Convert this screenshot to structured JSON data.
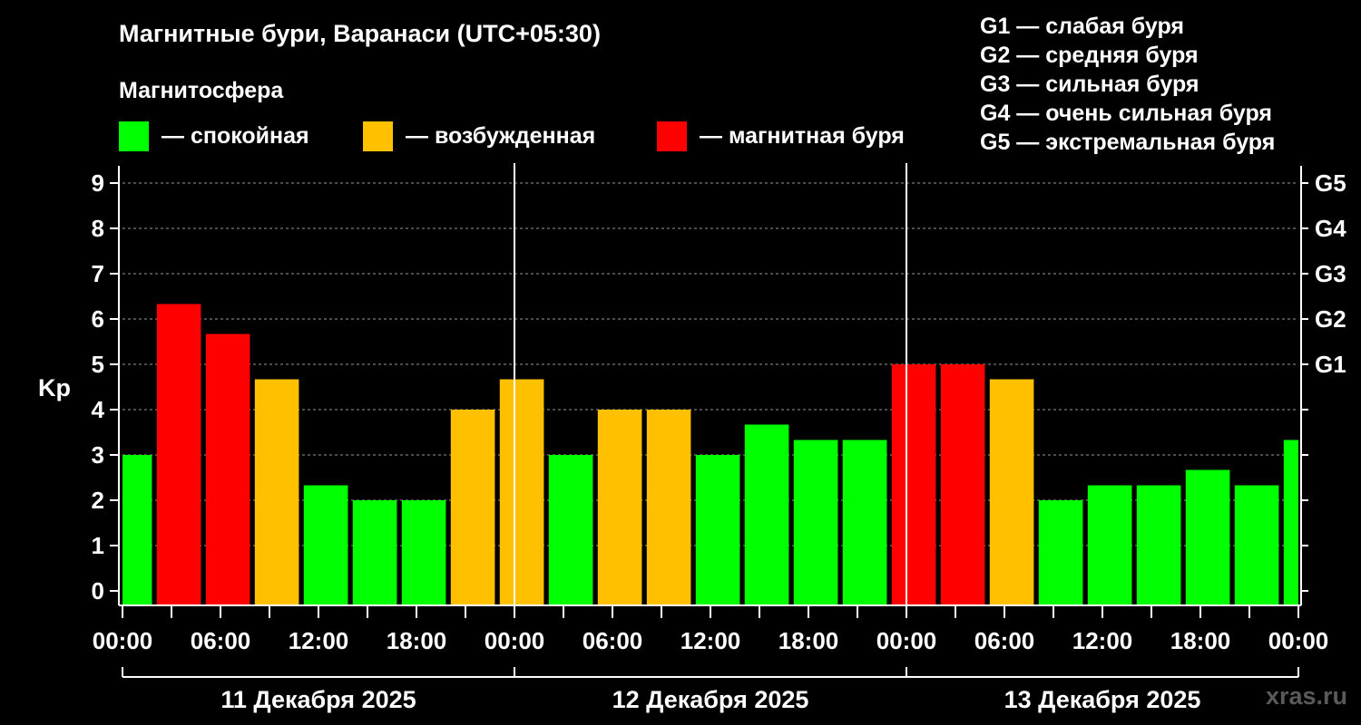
{
  "header": {
    "title": "Магнитные бури, Варанаси (UTC+05:30)",
    "legend_heading": "Магнитосфера"
  },
  "legend": [
    {
      "label": "— спокойная",
      "color": "#00ff00"
    },
    {
      "label": "— возбужденная",
      "color": "#ffc000"
    },
    {
      "label": "— магнитная буря",
      "color": "#ff0000"
    }
  ],
  "storm_scale": [
    {
      "label": "G1 — слабая буря"
    },
    {
      "label": "G2 — средняя буря"
    },
    {
      "label": "G3 — сильная буря"
    },
    {
      "label": "G4 — очень сильная буря"
    },
    {
      "label": "G5 — экстремальная буря"
    }
  ],
  "watermark": "xras.ru",
  "colors": {
    "background": "#000000",
    "quiet": "#00ff00",
    "active": "#ffc000",
    "storm": "#ff0000",
    "axis": "#ffffff",
    "grid": "#9a9a9a"
  },
  "chart_data": {
    "type": "bar",
    "ylabel": "Kp",
    "ylim": [
      0,
      9
    ],
    "yticks": [
      "0",
      "1",
      "2",
      "3",
      "4",
      "5",
      "6",
      "7",
      "8",
      "9"
    ],
    "grid": true,
    "right_axis": [
      {
        "label": "G1",
        "value": 5
      },
      {
        "label": "G2",
        "value": 6
      },
      {
        "label": "G3",
        "value": 7
      },
      {
        "label": "G4",
        "value": 8
      },
      {
        "label": "G5",
        "value": 9
      }
    ],
    "xlim_hours": [
      0,
      72
    ],
    "x_tick_labels": [
      "00:00",
      "06:00",
      "12:00",
      "18:00",
      "00:00",
      "06:00",
      "12:00",
      "18:00",
      "00:00",
      "06:00",
      "12:00",
      "18:00",
      "00:00"
    ],
    "day_labels": [
      "11 Декабря 2025",
      "12 Декабря 2025",
      "13 Декабря 2025"
    ],
    "series": [
      {
        "values": [
          {
            "start": 0,
            "end": 1.8,
            "kp": 3.0,
            "status": "quiet"
          },
          {
            "start": 2.1,
            "end": 4.8,
            "kp": 6.33,
            "status": "storm"
          },
          {
            "start": 5.1,
            "end": 7.8,
            "kp": 5.67,
            "status": "storm"
          },
          {
            "start": 8.1,
            "end": 10.8,
            "kp": 4.67,
            "status": "active"
          },
          {
            "start": 11.1,
            "end": 13.8,
            "kp": 2.33,
            "status": "quiet"
          },
          {
            "start": 14.1,
            "end": 16.8,
            "kp": 2.0,
            "status": "quiet"
          },
          {
            "start": 17.1,
            "end": 19.8,
            "kp": 2.0,
            "status": "quiet"
          },
          {
            "start": 20.1,
            "end": 22.8,
            "kp": 4.0,
            "status": "active"
          },
          {
            "start": 23.1,
            "end": 25.8,
            "kp": 4.67,
            "status": "active"
          },
          {
            "start": 26.1,
            "end": 28.8,
            "kp": 3.0,
            "status": "quiet"
          },
          {
            "start": 29.1,
            "end": 31.8,
            "kp": 4.0,
            "status": "active"
          },
          {
            "start": 32.1,
            "end": 34.8,
            "kp": 4.0,
            "status": "active"
          },
          {
            "start": 35.1,
            "end": 37.8,
            "kp": 3.0,
            "status": "quiet"
          },
          {
            "start": 38.1,
            "end": 40.8,
            "kp": 3.67,
            "status": "quiet"
          },
          {
            "start": 41.1,
            "end": 43.8,
            "kp": 3.33,
            "status": "quiet"
          },
          {
            "start": 44.1,
            "end": 46.8,
            "kp": 3.33,
            "status": "quiet"
          },
          {
            "start": 47.1,
            "end": 49.8,
            "kp": 5.0,
            "status": "storm"
          },
          {
            "start": 50.1,
            "end": 52.8,
            "kp": 5.0,
            "status": "storm"
          },
          {
            "start": 53.1,
            "end": 55.8,
            "kp": 4.67,
            "status": "active"
          },
          {
            "start": 56.1,
            "end": 58.8,
            "kp": 2.0,
            "status": "quiet"
          },
          {
            "start": 59.1,
            "end": 61.8,
            "kp": 2.33,
            "status": "quiet"
          },
          {
            "start": 62.1,
            "end": 64.8,
            "kp": 2.33,
            "status": "quiet"
          },
          {
            "start": 65.1,
            "end": 67.8,
            "kp": 2.67,
            "status": "quiet"
          },
          {
            "start": 68.1,
            "end": 70.8,
            "kp": 2.33,
            "status": "quiet"
          },
          {
            "start": 71.1,
            "end": 72,
            "kp": 3.33,
            "status": "quiet"
          }
        ]
      }
    ]
  }
}
